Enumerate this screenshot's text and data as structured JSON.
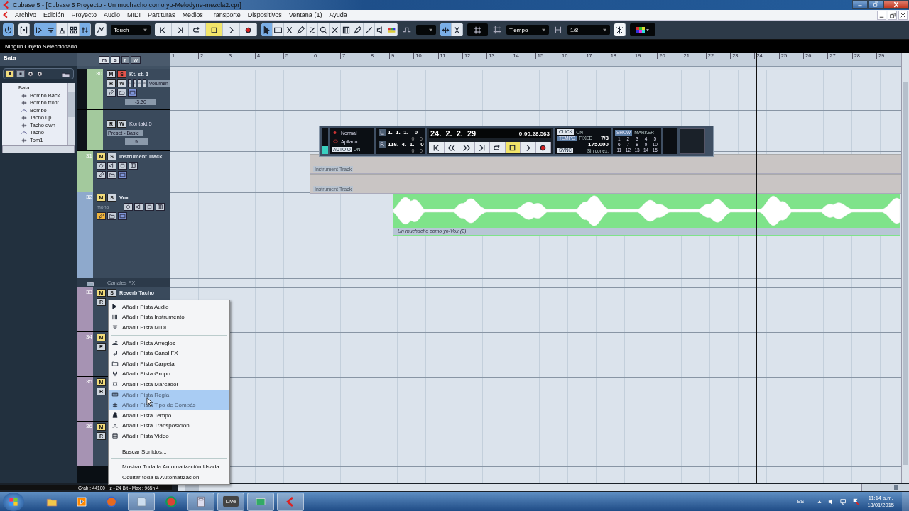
{
  "window": {
    "title": "Cubase 5 - [Cubase 5 Proyecto - Un muchacho como yo-Melodyne-mezcla2.cpr]"
  },
  "menu": [
    "Archivo",
    "Edición",
    "Proyecto",
    "Audio",
    "MIDI",
    "Partituras",
    "Medios",
    "Transporte",
    "Dispositivos",
    "Ventana (1)",
    "Ayuda"
  ],
  "toolbar": {
    "groups": [
      [
        {
          "kind": "power",
          "selected": true
        }
      ],
      [
        {
          "kind": "bracket",
          "selected": false
        }
      ],
      [
        {
          "kind": "panel",
          "selected": true
        },
        {
          "kind": "lines",
          "selected": true
        },
        {
          "kind": "arrange",
          "selected": false
        },
        {
          "kind": "grid4",
          "selected": false
        },
        {
          "kind": "sliders",
          "selected": true
        }
      ],
      [
        {
          "kind": "curve",
          "selected": false
        }
      ]
    ],
    "automation_mode": "Touch",
    "transport": [
      {
        "kind": "tostart",
        "selected": false
      },
      {
        "kind": "toend",
        "selected": false
      },
      {
        "kind": "cycle",
        "selected": false
      },
      {
        "kind": "stop",
        "selected": true
      },
      {
        "kind": "play",
        "selected": false
      },
      {
        "kind": "record",
        "selected": false
      }
    ],
    "tools": [
      {
        "kind": "pointer",
        "selected": true
      },
      {
        "kind": "range",
        "selected": false
      },
      {
        "kind": "scissors",
        "selected": false
      },
      {
        "kind": "pencil",
        "selected": false
      },
      {
        "kind": "glue",
        "selected": false
      },
      {
        "kind": "zoom",
        "selected": false
      },
      {
        "kind": "cross",
        "selected": false
      },
      {
        "kind": "comp",
        "selected": false
      },
      {
        "kind": "pencil",
        "selected": false
      },
      {
        "kind": "line",
        "selected": false
      },
      {
        "kind": "speaker",
        "selected": false
      },
      {
        "kind": "palette",
        "selected": false
      }
    ],
    "nudge": "-",
    "snap": [
      {
        "kind": "snap",
        "selected": true
      },
      {
        "kind": "snapx",
        "selected": false
      }
    ],
    "snap_type": "Tiempo",
    "quantize": "1/8",
    "crosshair_selected": true
  },
  "info_line": "Ningún Objeto Seleccionado",
  "inspector": {
    "title": "Bata",
    "buttons": [
      {
        "kind": "mute",
        "selected": true
      },
      {
        "kind": "solo",
        "selected": false
      }
    ],
    "tree": {
      "label": "Bata",
      "children": [
        {
          "label": "Bombo Back",
          "kind": "audio"
        },
        {
          "label": "Bombo front",
          "kind": "audio"
        },
        {
          "label": "Bombo",
          "kind": "curve"
        },
        {
          "label": "Tacho up",
          "kind": "audio"
        },
        {
          "label": "Tacho dwn",
          "kind": "audio"
        },
        {
          "label": "Tacho",
          "kind": "curve"
        },
        {
          "label": "Tom1",
          "kind": "audio"
        }
      ]
    }
  },
  "tracklist_header": [
    "m",
    "s",
    "r",
    "w"
  ],
  "tracks": [
    {
      "children": [
        {
          "kind": "instrument",
          "number": "30",
          "name": "Kt. st. 1",
          "color": "#a3c99d",
          "buttons": [
            {
              "label": "M",
              "on": false
            },
            {
              "label": "S",
              "on": true
            }
          ],
          "rw": [
            "R",
            "W"
          ],
          "param": "Volumen",
          "value": "-3.30"
        },
        {
          "kind": "midi",
          "name": "Kontakt 5",
          "color": "#a3c99d",
          "rw": [
            "R",
            "W"
          ],
          "param": "Preset - Basic I",
          "value": "9"
        }
      ]
    },
    {
      "kind": "instrument",
      "number": "31",
      "name": "Instrument Track",
      "color": "#a3c99d",
      "buttons": [
        {
          "label": "M",
          "on": true
        },
        {
          "label": "S",
          "on": false
        }
      ],
      "events": [
        {
          "label": "Instrument Track"
        },
        {
          "label": "Instrument Track"
        }
      ]
    },
    {
      "kind": "audio",
      "number": "32",
      "name": "Vox",
      "sub": "mono",
      "color": "#8ea9cc",
      "buttons": [
        {
          "label": "M",
          "on": true
        },
        {
          "label": "S",
          "on": false
        }
      ],
      "events": [
        {
          "label": "Un muchacho como yo-Vox (2)"
        }
      ]
    },
    {
      "kind": "group",
      "name": "Canales FX"
    },
    {
      "kind": "fx",
      "number": "33",
      "name": "Reverb Tacho",
      "color": "#a693b3",
      "buttons": [
        {
          "label": "M",
          "on": true
        },
        {
          "label": "S",
          "on": false
        }
      ],
      "rw": [
        "R"
      ]
    },
    {
      "kind": "fx",
      "number": "34",
      "color": "#a693b3",
      "buttons": [
        {
          "label": "M",
          "on": true
        }
      ],
      "rw": [
        "R"
      ]
    },
    {
      "kind": "fx",
      "number": "35",
      "color": "#a693b3",
      "buttons": [
        {
          "label": "M",
          "on": true
        }
      ],
      "rw": [
        "R"
      ]
    },
    {
      "kind": "fx",
      "number": "36",
      "color": "#a693b3",
      "buttons": [
        {
          "label": "M",
          "on": true
        }
      ],
      "rw": [
        "R"
      ]
    }
  ],
  "ruler": [
    "1",
    "2",
    "3",
    "4",
    "5",
    "6",
    "7",
    "8",
    "9",
    "10",
    "11",
    "12",
    "13",
    "14",
    "15",
    "16",
    "17",
    "18",
    "19",
    "20",
    "21",
    "22",
    "23",
    "24",
    "25",
    "26",
    "27",
    "28",
    "29"
  ],
  "transport": {
    "mode": "Normal",
    "record_mode": "Apilado",
    "autoq": "AUTO Q",
    "autoq_state": "ON",
    "left_locator": "1.  1.  1.    0",
    "left_sub": "0    0",
    "right_locator": "116.  4.  1.    0",
    "right_sub": "0    0",
    "position": "24.  2.  2.  29",
    "time": "0:00:28.563",
    "buttons": [
      {
        "kind": "tostart",
        "selected": false
      },
      {
        "kind": "rewind",
        "selected": false
      },
      {
        "kind": "forward",
        "selected": false
      },
      {
        "kind": "toend",
        "selected": false
      },
      {
        "kind": "cycle",
        "selected": false
      },
      {
        "kind": "stop",
        "selected": true
      },
      {
        "kind": "play",
        "selected": false
      },
      {
        "kind": "record",
        "selected": false
      }
    ],
    "click": "CLICK",
    "click_state": "ON",
    "tempo": "TEMPO",
    "tempo_mode": "FIXED",
    "signature": "7/8",
    "bpm": "175.000",
    "sync": "SYNC",
    "sync_state": "Sin conex.",
    "show": "SHOW",
    "marker": "MARKER",
    "markers": [
      "1",
      "2",
      "3",
      "4",
      "5",
      "6",
      "7",
      "8",
      "9",
      "10",
      "11",
      "12",
      "13",
      "14",
      "15"
    ]
  },
  "context_menu": [
    [
      {
        "label": "Añadir Pista Audio",
        "selected": false,
        "disabled": false
      },
      {
        "label": "Añadir Pista Instrumento",
        "selected": false,
        "disabled": false
      },
      {
        "label": "Añadir Pista MIDI",
        "selected": false,
        "disabled": false
      }
    ],
    [
      {
        "label": "Añadir Pista Arreglos",
        "selected": false,
        "disabled": false
      },
      {
        "label": "Añadir Pista Canal FX",
        "selected": false,
        "disabled": false
      },
      {
        "label": "Añadir Pista Carpeta",
        "selected": false,
        "disabled": false
      },
      {
        "label": "Añadir Pista Grupo",
        "selected": false,
        "disabled": false
      },
      {
        "label": "Añadir Pista Marcador",
        "selected": false,
        "disabled": false
      },
      {
        "label": "Añadir Pista Regla",
        "selected": true,
        "disabled": true
      },
      {
        "label": "Añadir Pista Tipo de Compás",
        "selected": true,
        "disabled": true
      },
      {
        "label": "Añadir Pista Tempo",
        "selected": false,
        "disabled": false
      },
      {
        "label": "Añadir Pista Transposición",
        "selected": false,
        "disabled": false
      },
      {
        "label": "Añadir Pista Video",
        "selected": false,
        "disabled": false
      }
    ],
    [
      {
        "label": "Buscar Sonidos...",
        "selected": false,
        "disabled": false
      }
    ],
    [
      {
        "label": "Mostrar Toda la Automatización Usada",
        "selected": false,
        "disabled": false
      },
      {
        "label": "Ocultar toda la Automatización",
        "selected": false,
        "disabled": false
      }
    ]
  ],
  "status_bar": "Grab.: 44100 Hz - 24 Bit - Max : 965h 4",
  "zoom_slider": {
    "level": 0.72
  },
  "taskbar": {
    "apps": [
      {
        "kind": "explorer",
        "selected": false
      },
      {
        "kind": "media",
        "selected": false
      },
      {
        "kind": "firefox",
        "selected": false
      },
      {
        "kind": "notes",
        "selected": true
      },
      {
        "kind": "chrome",
        "selected": false
      },
      {
        "kind": "calc",
        "selected": true
      },
      {
        "kind": "live",
        "label": "Live",
        "selected": true
      },
      {
        "kind": "game",
        "selected": true
      },
      {
        "kind": "cubase",
        "selected": true
      }
    ],
    "language": "ES",
    "time": "11:14 a.m.",
    "date": "18/01/2015"
  }
}
